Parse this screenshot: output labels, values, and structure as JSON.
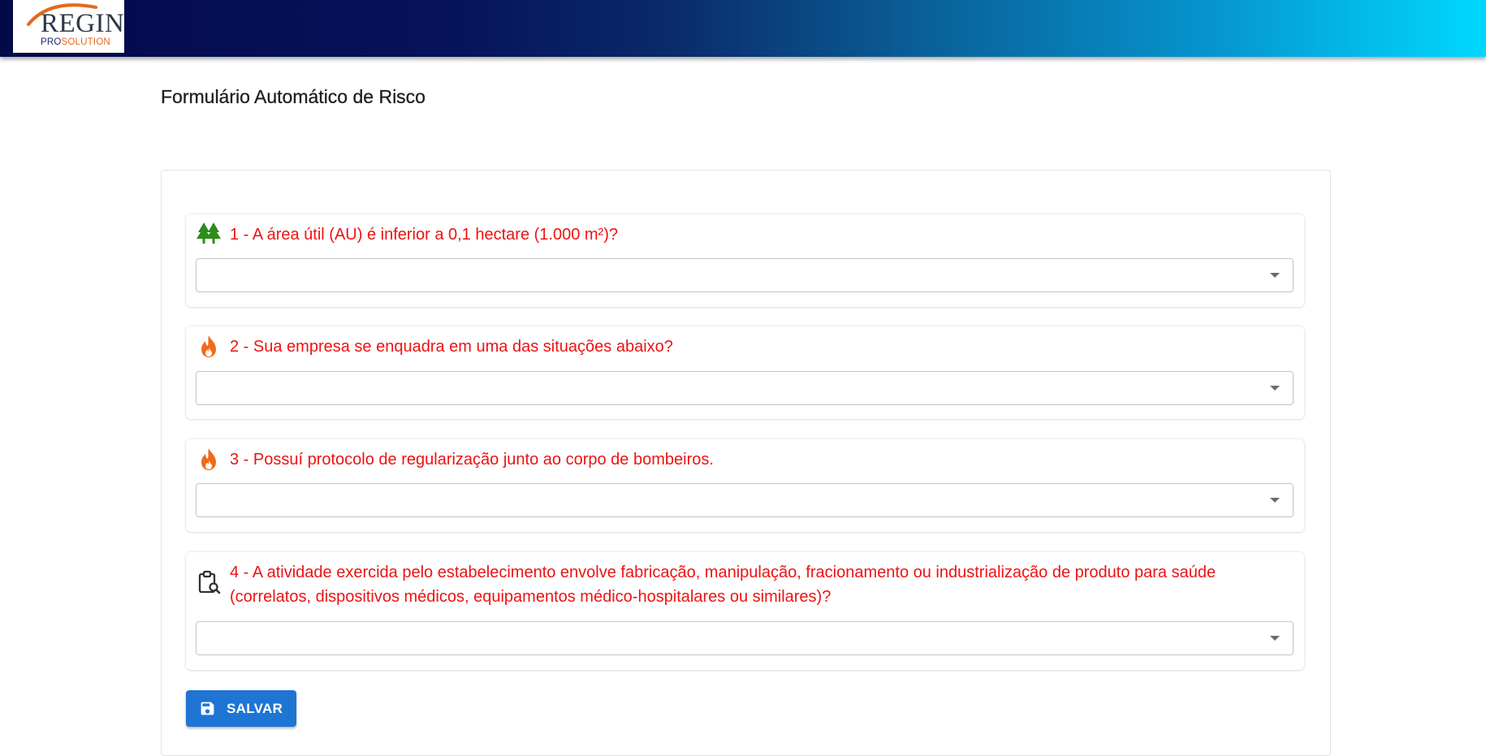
{
  "header": {
    "logo_main": "REGIN",
    "logo_sub_pro": "PRO",
    "logo_sub_solution": "SOLUTION"
  },
  "page": {
    "title": "Formulário Automático de Risco"
  },
  "questions": [
    {
      "icon": "trees-icon",
      "label": "1 - A área útil (AU) é inferior a 0,1 hectare (1.000 m²)?",
      "value": ""
    },
    {
      "icon": "fire-icon",
      "label": "2 - Sua empresa se enquadra em uma das situações abaixo?",
      "value": ""
    },
    {
      "icon": "fire-icon",
      "label": "3 - Possuí protocolo de regularização junto ao corpo de bombeiros.",
      "value": ""
    },
    {
      "icon": "clipboard-search-icon",
      "label": "4 - A atividade exercida pelo estabelecimento envolve fabricação, manipulação, fracionamento ou industrialização de produto para saúde (correlatos, dispositivos médicos, equipamentos médico-hospitalares ou similares)?",
      "value": ""
    }
  ],
  "actions": {
    "save_label": "SALVAR"
  },
  "colors": {
    "question_text": "#ee1212",
    "trees_icon": "#2e8b1e",
    "fire_icon": "#f26a1b",
    "button": "#1e75d4",
    "header_gradient_start": "#030a4a",
    "header_gradient_end": "#00d8ff"
  }
}
